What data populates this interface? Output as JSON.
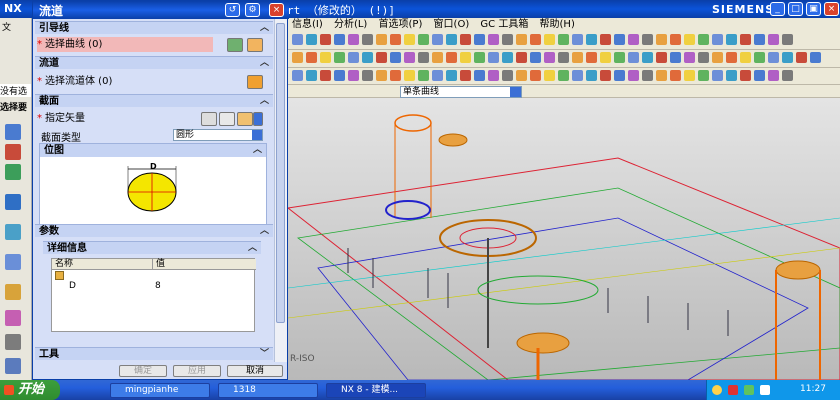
{
  "window": {
    "app_name": "NX",
    "document_title": "rt  （修改的）     (!)]",
    "brand": "SIEMENS"
  },
  "menu": [
    "信息(I)",
    "分析(L)",
    "首选项(P)",
    "窗口(O)",
    "GC 工具箱",
    "帮助(H)"
  ],
  "toolbar": {
    "selection_filter": "单条曲线"
  },
  "left_strip": {
    "visible_text": [
      "文",
      "没有选",
      "选择要"
    ]
  },
  "dialog": {
    "title": "流道",
    "sections": {
      "guide": {
        "header": "引导线",
        "row_label": "选择曲线 (0)"
      },
      "runner": {
        "header": "流道",
        "row_label": "选择流道体 (0)"
      },
      "section": {
        "header": "截面",
        "vector_label": "指定矢量",
        "type_label": "截面类型",
        "type_value": "圆形",
        "position_header": "位图",
        "diagram_label": "D"
      },
      "params": {
        "header": "参数",
        "details_header": "详细信息",
        "columns": [
          "名称",
          "值"
        ],
        "rows": [
          {
            "name": "D",
            "value": "8"
          }
        ]
      },
      "tools": {
        "header": "工具"
      }
    },
    "buttons": {
      "ok": "确定",
      "apply": "应用",
      "cancel": "取消"
    }
  },
  "viewport": {
    "label": "R-ISO"
  },
  "taskbar": {
    "start": "开始",
    "tasks": [
      "mingpianhe",
      "1318",
      "NX 8 - 建模..."
    ],
    "clock": "11:27"
  },
  "colors": {
    "title_blue": "#0a3fa8",
    "dialog_bg": "#d6dff7",
    "required_star": "#dd0000",
    "highlight": "#f2b8b8"
  }
}
